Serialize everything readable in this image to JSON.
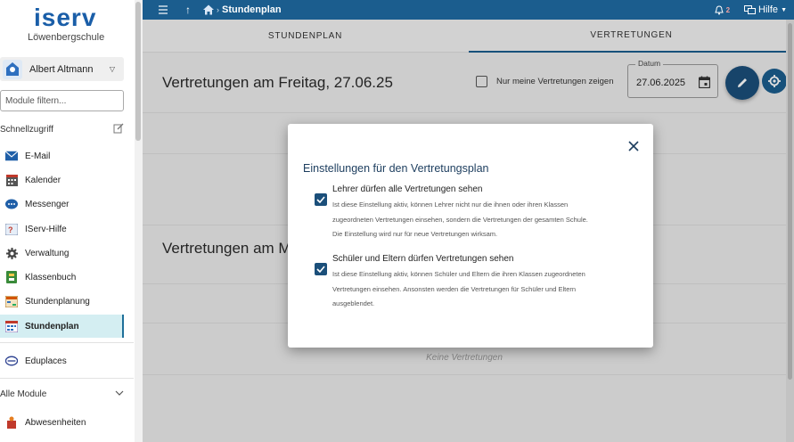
{
  "brand": {
    "logo_text": "iserv",
    "school": "Löwenbergschule",
    "accent": "#1b5d8e",
    "active_bg": "#d4eef2"
  },
  "user": {
    "name": "Albert Altmann"
  },
  "filter": {
    "placeholder": "Module filtern..."
  },
  "sidebar": {
    "quick_access_label": "Schnellzugriff",
    "items": [
      {
        "label": "E-Mail",
        "icon": "mail-icon"
      },
      {
        "label": "Kalender",
        "icon": "calendar-icon"
      },
      {
        "label": "Messenger",
        "icon": "chat-icon"
      },
      {
        "label": "IServ-Hilfe",
        "icon": "help-icon"
      },
      {
        "label": "Verwaltung",
        "icon": "gear-icon"
      },
      {
        "label": "Klassenbuch",
        "icon": "book-icon"
      },
      {
        "label": "Stundenplanung",
        "icon": "planning-icon"
      },
      {
        "label": "Stundenplan",
        "icon": "timetable-icon",
        "active": true
      }
    ],
    "eduplaces": {
      "label": "Eduplaces",
      "icon": "eduplaces-icon"
    },
    "all_modules_label": "Alle Module",
    "more_items": [
      {
        "label": "Abwesenheiten",
        "icon": "absence-icon"
      }
    ]
  },
  "topbar": {
    "breadcrumb": "Stundenplan",
    "notification_count": "2",
    "help_label": "Hilfe"
  },
  "tabs": [
    {
      "label": "STUNDENPLAN",
      "active": false
    },
    {
      "label": "VERTRETUNGEN",
      "active": true
    }
  ],
  "main": {
    "day1_title": "Vertretungen am Freitag, 27.06.25",
    "only_mine_label": "Nur meine Vertretungen zeigen",
    "date_label": "Datum",
    "date_value": "27.06.2025",
    "day2_title": "Vertretungen am Mo",
    "no_entries": "Keine Vertretungen"
  },
  "modal": {
    "title": "Einstellungen für den Vertretungsplan",
    "options": [
      {
        "title": "Lehrer dürfen alle Vertretungen sehen",
        "checked": true,
        "desc": [
          "Ist diese Einstellung aktiv, können Lehrer nicht nur die ihnen oder ihren Klassen",
          "zugeordneten Vertretungen einsehen, sondern die Vertretungen der gesamten Schule.",
          "Die Einstellung wird nur für neue Vertretungen wirksam."
        ]
      },
      {
        "title": "Schüler und Eltern dürfen Vertretungen sehen",
        "checked": true,
        "desc": [
          "Ist diese Einstellung aktiv, können Schüler und Eltern die ihren Klassen zugeordneten",
          "Vertretungen einsehen. Ansonsten werden die Vertretungen für Schüler und Eltern",
          "ausgeblendet."
        ]
      }
    ]
  }
}
